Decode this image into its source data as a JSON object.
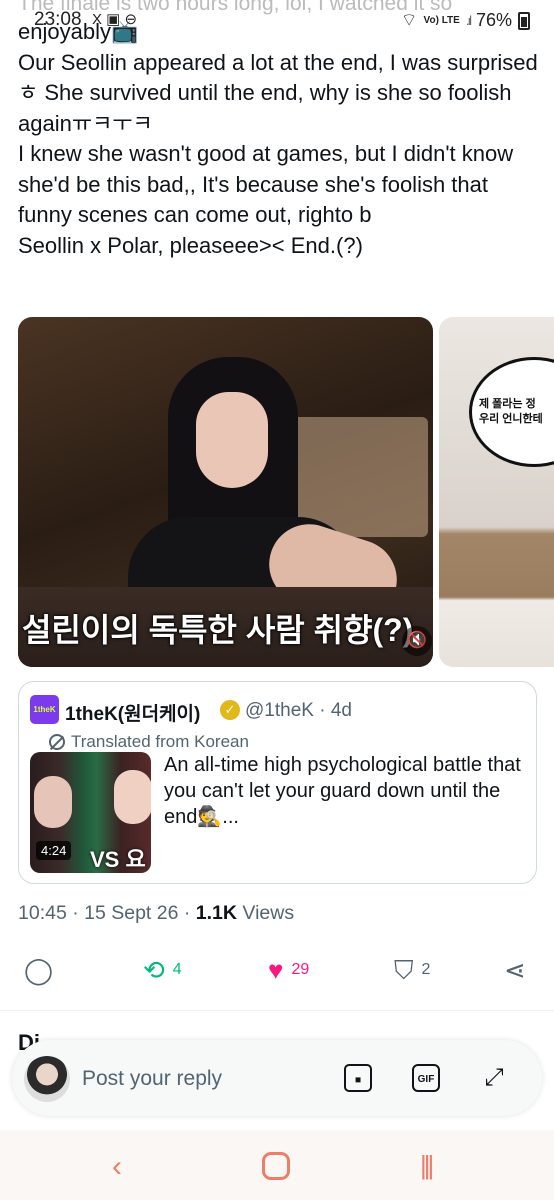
{
  "status_bar": {
    "time": "23:08",
    "left_icons": "X ▣ ⊖",
    "network": "Vo) LTE",
    "signal": ".ıl",
    "battery": "76%"
  },
  "tweet": {
    "cut_line": "The finale is two hours long, lol, I watched it so",
    "lines": [
      "enjoyably📺",
      "Our Seollin appeared a lot at the end, I was surprisedㅎ She survived until the end, why is she so foolish againㅠㅋㅜㅋ",
      "I knew she wasn't good at games, but I didn't know she'd be this bad,, It's because she's foolish that funny scenes can come out, righto b",
      "Seollin x Polar, pleaseee>< End.(?)"
    ]
  },
  "media": {
    "caption": "설린이의 독특한 사람 취향(?)",
    "second_bubble": "제 폴라는 정\n우리 언니한테"
  },
  "quote": {
    "avatar_label": "1theK",
    "name": "1theK(원더케이)",
    "handle": "@1theK · 4d",
    "translated": "Translated from Korean",
    "duration": "4:24",
    "thumb_text": "VS 요",
    "body": "An all-time high psychological battle that you can't let your guard down until the end🕵️..."
  },
  "meta": {
    "time_date": "10:45 · 15 Sept 26 · ",
    "views_count": "1.1K",
    "views_label": " Views"
  },
  "actions": {
    "retweets": "4",
    "likes": "29",
    "bookmarks": "2"
  },
  "peek": "Di",
  "reply": {
    "placeholder": "Post your reply",
    "gif_label": "GIF"
  },
  "colors": {
    "retweet": "#00ba7c",
    "like": "#f91880",
    "secondary_text": "#536471",
    "nav": "#ec7d6a"
  }
}
